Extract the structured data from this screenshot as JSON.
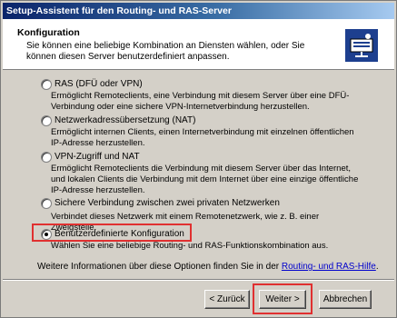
{
  "window": {
    "title": "Setup-Assistent für den Routing- und RAS-Server"
  },
  "header": {
    "title": "Konfiguration",
    "subtitle": "Sie können eine beliebige Kombination an Diensten wählen, oder Sie können diesen Server benutzerdefiniert anpassen.",
    "icon": "server-network-icon"
  },
  "options": [
    {
      "label": "RAS (DFÜ oder VPN)",
      "description": "Ermöglicht Remoteclients, eine Verbindung mit diesem Server über eine DFÜ-Verbindung oder eine sichere VPN-Internetverbindung herzustellen.",
      "checked": false
    },
    {
      "label": "Netzwerkadressübersetzung (NAT)",
      "description": "Ermöglicht internen Clients, einen Internetverbindung mit einzelnen öffentlichen IP-Adresse herzustellen.",
      "checked": false
    },
    {
      "label": "VPN-Zugriff und NAT",
      "description": "Ermöglicht Remoteclients die Verbindung mit diesem Server über das Internet, und lokalen Clients die Verbindung mit dem Internet über eine einzige öffentliche IP-Adresse herzustellen.",
      "checked": false
    },
    {
      "label": "Sichere Verbindung zwischen zwei privaten Netzwerken",
      "description": "Verbindet dieses Netzwerk mit einem Remotenetzwerk, wie z. B. einer Zweigstelle.",
      "checked": false
    },
    {
      "label": "Benutzerdefinierte Konfiguration",
      "description": "Wählen Sie eine beliebige Routing- und RAS-Funktionskombination aus.",
      "checked": true
    }
  ],
  "info": {
    "text": "Weitere Informationen über diese Optionen finden Sie in der ",
    "link": "Routing- und RAS-Hilfe",
    "suffix": "."
  },
  "buttons": {
    "back": "< Zurück",
    "next": "Weiter >",
    "cancel": "Abbrechen"
  },
  "colors": {
    "titlebar_start": "#0a246a",
    "titlebar_end": "#a6caf0",
    "dialog_bg": "#d4d0c8",
    "highlight": "#e03030",
    "link": "#0000cc"
  }
}
